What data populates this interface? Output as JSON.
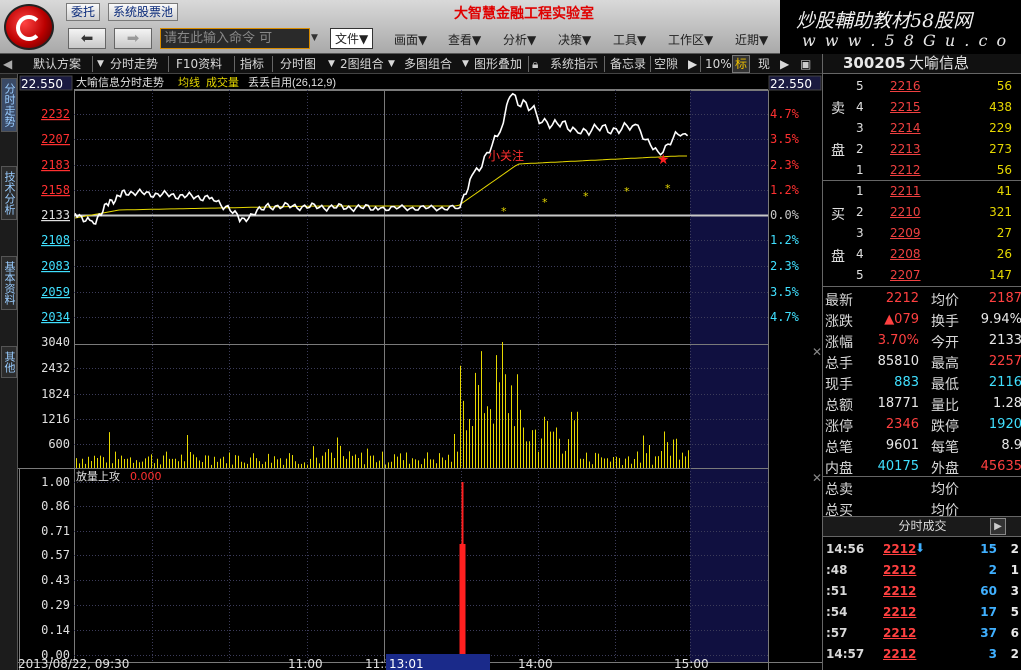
{
  "titlebar": {
    "btn_delegate": "委托",
    "btn_pool": "系统股票池",
    "app_title": "大智慧金融工程实验室",
    "brand_line1": "炒股輔助教材58股网",
    "brand_line2": "w w w . 5 8 G u . c o m"
  },
  "search": {
    "placeholder": "请在此输入命令  可"
  },
  "menus": [
    "文件▼",
    "画面▼",
    "查看▼",
    "分析▼",
    "决策▼",
    "工具▼",
    "工作区▼",
    "近期▼"
  ],
  "toolbar": [
    "默认方案",
    "分时走势",
    "F10资料",
    "指标",
    "分时图",
    "2图组合",
    "多图组合",
    "图形叠加",
    "系统指示",
    "备忘录",
    "空隙",
    "10%",
    "标",
    "现"
  ],
  "left_tabs": [
    "分时走势",
    "技术分析",
    "基本资料",
    "其他"
  ],
  "chart": {
    "price_top_left": "22.550",
    "price_top_right": "22.550",
    "legend": {
      "name": "大喻信息分时走势",
      "avg": "均线",
      "vol": "成交量",
      "custom": "丢丢自用(26,12,9)"
    },
    "price_ticks": [
      "2232",
      "2207",
      "2183",
      "2158",
      "2133",
      "2108",
      "2083",
      "2059",
      "2034"
    ],
    "pct_ticks": [
      "4.7%",
      "3.5%",
      "2.3%",
      "1.2%",
      "0.0%",
      "1.2%",
      "2.3%",
      "3.5%",
      "4.7%"
    ],
    "vol_ticks": [
      "3040",
      "2432",
      "1824",
      "1216",
      "600"
    ],
    "ind_label": "放量上攻",
    "ind_value": "0.000",
    "ind_ticks": [
      "1.00",
      "0.86",
      "0.71",
      "0.57",
      "0.43",
      "0.29",
      "0.14",
      "0.00"
    ],
    "annotation": "小关注",
    "time_labels": [
      "2013/08/22, 09:30",
      "11:00",
      "11:3",
      "13:01",
      "14:00",
      "15:00"
    ],
    "colors": {
      "up": "#ff3030",
      "down": "#40e0ff",
      "price_line": "#ffffff",
      "avg_line": "#e6d800",
      "volume": "#e6d800",
      "signal": "#ff2020"
    }
  },
  "panel": {
    "code": "300205",
    "name": "大喻信息",
    "sell_label": [
      "卖",
      "盘"
    ],
    "buy_label": [
      "买",
      "盘"
    ],
    "sell": [
      {
        "idx": "5",
        "price": "2216",
        "vol": "56"
      },
      {
        "idx": "4",
        "price": "2215",
        "vol": "438"
      },
      {
        "idx": "3",
        "price": "2214",
        "vol": "229"
      },
      {
        "idx": "2",
        "price": "2213",
        "vol": "273"
      },
      {
        "idx": "1",
        "price": "2212",
        "vol": "56"
      }
    ],
    "buy": [
      {
        "idx": "1",
        "price": "2211",
        "vol": "41"
      },
      {
        "idx": "2",
        "price": "2210",
        "vol": "321"
      },
      {
        "idx": "3",
        "price": "2209",
        "vol": "27"
      },
      {
        "idx": "4",
        "price": "2208",
        "vol": "26"
      },
      {
        "idx": "5",
        "price": "2207",
        "vol": "147"
      }
    ],
    "quotes": [
      {
        "k1": "最新",
        "v1": "2212",
        "c1": "red",
        "k2": "均价",
        "v2": "2187",
        "c2": "red"
      },
      {
        "k1": "涨跌",
        "v1": "▲079",
        "c1": "red",
        "k2": "换手",
        "v2": "9.94%",
        "c2": "white"
      },
      {
        "k1": "涨幅",
        "v1": "3.70%",
        "c1": "red",
        "k2": "今开",
        "v2": "2133",
        "c2": "white"
      },
      {
        "k1": "总手",
        "v1": "85810",
        "c1": "white",
        "k2": "最高",
        "v2": "2257",
        "c2": "red"
      },
      {
        "k1": "现手",
        "v1": "883",
        "c1": "cyan",
        "k2": "最低",
        "v2": "2116",
        "c2": "cyan"
      },
      {
        "k1": "总额",
        "v1": "18771",
        "c1": "white",
        "k2": "量比",
        "v2": "1.28",
        "c2": "white"
      },
      {
        "k1": "涨停",
        "v1": "2346",
        "c1": "red",
        "k2": "跌停",
        "v2": "1920",
        "c2": "cyan"
      },
      {
        "k1": "总笔",
        "v1": "9601",
        "c1": "white",
        "k2": "每笔",
        "v2": "8.9",
        "c2": "white"
      },
      {
        "k1": "内盘",
        "v1": "40175",
        "c1": "cyan",
        "k2": "外盘",
        "v2": "45635",
        "c2": "red"
      },
      {
        "k1": "总卖",
        "v1": "",
        "c1": "white",
        "k2": "均价",
        "v2": "",
        "c2": "white"
      },
      {
        "k1": "总买",
        "v1": "",
        "c1": "white",
        "k2": "均价",
        "v2": "",
        "c2": "white"
      }
    ],
    "tick_title": "分时成交",
    "ticks": [
      {
        "t": "14:56",
        "p": "2212",
        "arrow": "⬇",
        "v": "15",
        "n": "2"
      },
      {
        "t": ":48",
        "p": "2212",
        "arrow": "",
        "v": "2",
        "n": "1"
      },
      {
        "t": ":51",
        "p": "2212",
        "arrow": "",
        "v": "60",
        "n": "3"
      },
      {
        "t": ":54",
        "p": "2212",
        "arrow": "",
        "v": "17",
        "n": "5"
      },
      {
        "t": ":57",
        "p": "2212",
        "arrow": "",
        "v": "37",
        "n": "6"
      },
      {
        "t": "14:57",
        "p": "2212",
        "arrow": "",
        "v": "3",
        "n": "2"
      }
    ]
  }
}
